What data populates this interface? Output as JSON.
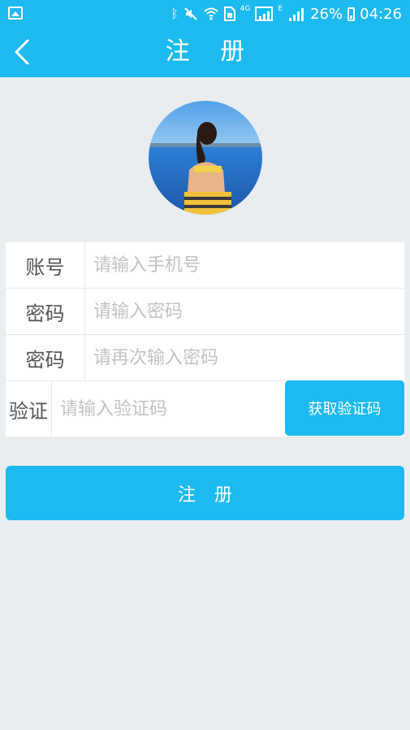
{
  "status_bar": {
    "battery_percent": "26%",
    "time": "04:26",
    "network_4g": "4G",
    "network_e": "E",
    "icons": [
      "gallery-icon",
      "bluetooth-icon",
      "mute-icon",
      "wifi-icon",
      "sim-icon",
      "signal-icon",
      "battery-icon"
    ]
  },
  "nav": {
    "title": "注 册"
  },
  "form": {
    "rows": [
      {
        "label": "账号",
        "placeholder": "请输入手机号"
      },
      {
        "label": "密码",
        "placeholder": "请输入密码"
      },
      {
        "label": "密码",
        "placeholder": "请再次输入密码"
      },
      {
        "label": "验证",
        "placeholder": "请输入验证码"
      }
    ],
    "get_code_label": "获取验证码"
  },
  "submit_label": "注 册",
  "colors": {
    "primary": "#1DB9F1",
    "background": "#E9EDF0",
    "placeholder": "#C3C3C3",
    "label": "#555555"
  }
}
